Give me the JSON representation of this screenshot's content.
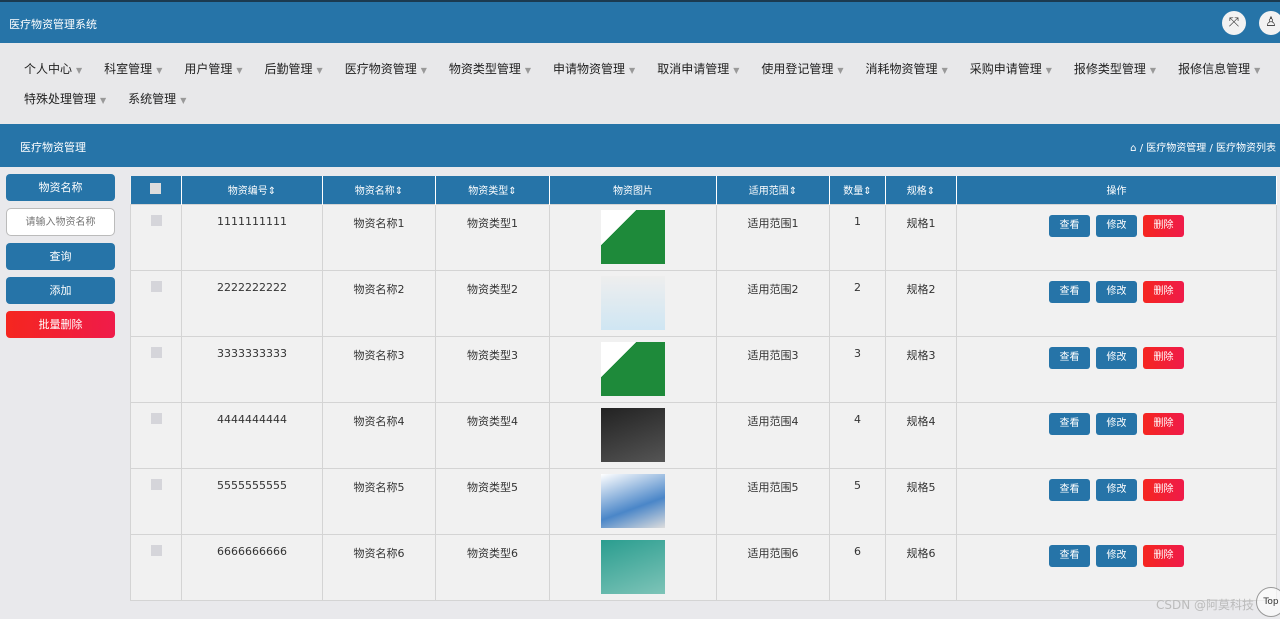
{
  "app_title": "医疗物资管理系统",
  "header_icons": [
    "fullscreen-icon",
    "user-icon"
  ],
  "nav": [
    "个人中心",
    "科室管理",
    "用户管理",
    "后勤管理",
    "医疗物资管理",
    "物资类型管理",
    "申请物资管理",
    "取消申请管理",
    "使用登记管理",
    "消耗物资管理",
    "采购申请管理",
    "报修类型管理",
    "报修信息管理",
    "特殊处理管理",
    "系统管理"
  ],
  "page_title": "医疗物资管理",
  "breadcrumb": [
    "医疗物资管理",
    "医疗物资列表"
  ],
  "side": {
    "label": "物资名称",
    "placeholder": "请输入物资名称",
    "query": "查询",
    "add": "添加",
    "batch_delete": "批量删除"
  },
  "columns": [
    "物资编号",
    "物资名称",
    "物资类型",
    "物资图片",
    "适用范围",
    "数量",
    "规格",
    "操作"
  ],
  "actions": {
    "view": "查看",
    "edit": "修改",
    "delete": "删除"
  },
  "rows": [
    {
      "code": "1111111111",
      "name": "物资名称1",
      "type": "物资类型1",
      "scope": "适用范围1",
      "qty": "1",
      "spec": "规格1"
    },
    {
      "code": "2222222222",
      "name": "物资名称2",
      "type": "物资类型2",
      "scope": "适用范围2",
      "qty": "2",
      "spec": "规格2"
    },
    {
      "code": "3333333333",
      "name": "物资名称3",
      "type": "物资类型3",
      "scope": "适用范围3",
      "qty": "3",
      "spec": "规格3"
    },
    {
      "code": "4444444444",
      "name": "物资名称4",
      "type": "物资类型4",
      "scope": "适用范围4",
      "qty": "4",
      "spec": "规格4"
    },
    {
      "code": "5555555555",
      "name": "物资名称5",
      "type": "物资类型5",
      "scope": "适用范围5",
      "qty": "5",
      "spec": "规格5"
    },
    {
      "code": "6666666666",
      "name": "物资名称6",
      "type": "物资类型6",
      "scope": "适用范围6",
      "qty": "6",
      "spec": "规格6"
    }
  ],
  "watermark": "CSDN @阿莫科技",
  "back_to_top": "Top"
}
